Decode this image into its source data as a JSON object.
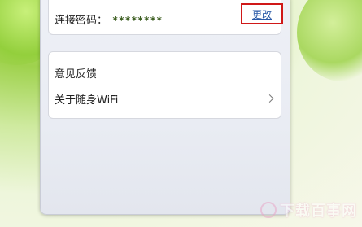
{
  "connection": {
    "password_label": "连接密码：",
    "password_value": "********",
    "change_label": "更改"
  },
  "menu": {
    "items": [
      {
        "label": "意见反馈"
      },
      {
        "label": "关于随身WiFi"
      }
    ]
  },
  "watermark": {
    "text": "下载百事网"
  },
  "colors": {
    "highlight_border": "#d01818",
    "link": "#2a5aa8"
  }
}
